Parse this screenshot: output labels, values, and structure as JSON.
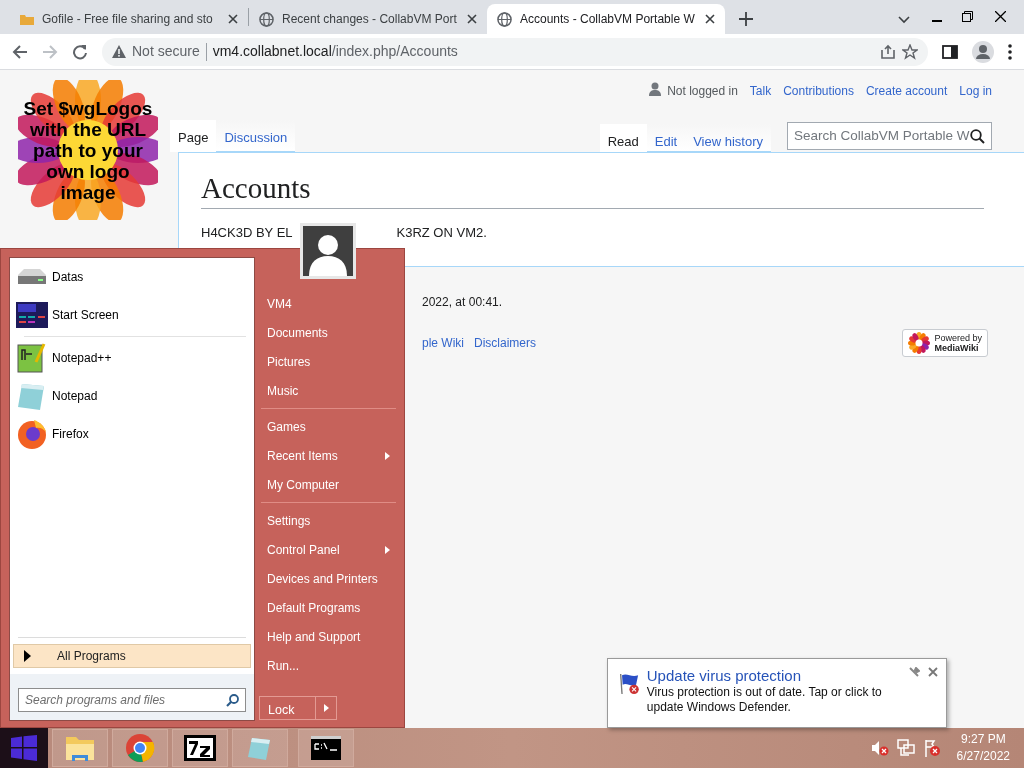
{
  "browser": {
    "tabs": [
      {
        "title": "Gofile - Free file sharing and sto",
        "selected": false
      },
      {
        "title": "Recent changes - CollabVM Port",
        "selected": false
      },
      {
        "title": "Accounts - CollabVM Portable W",
        "selected": true
      }
    ],
    "address": {
      "security": "Not secure",
      "host": "vm4.collabnet.local",
      "path": "/index.php/Accounts"
    }
  },
  "wiki": {
    "logo_text": "Set $wgLogos with the URL path to your own logo image",
    "personal": [
      "Not logged in",
      "Talk",
      "Contributions",
      "Create account",
      "Log in"
    ],
    "left_tabs": [
      {
        "label": "Page",
        "selected": true
      },
      {
        "label": "Discussion",
        "selected": false
      }
    ],
    "right_tabs": [
      {
        "label": "Read",
        "selected": true
      },
      {
        "label": "Edit",
        "selected": false
      },
      {
        "label": "View history",
        "selected": false
      }
    ],
    "search": {
      "placeholder": "Search CollabVM Portable W"
    },
    "heading": "Accounts",
    "body_parts": [
      "H4CK3D BY EL",
      "K3RZ ON VM2."
    ],
    "footer": {
      "last_edited": "2022, at 00:41.",
      "links": [
        "ple Wiki",
        "Disclaimers"
      ],
      "powered_by": [
        "Powered by",
        "MediaWiki"
      ]
    }
  },
  "start_menu": {
    "pinned_groups": [
      [
        "Datas",
        "Start Screen"
      ],
      [
        "Notepad++",
        "Notepad",
        "Firefox"
      ]
    ],
    "all_programs": "All Programs",
    "search": {
      "placeholder": "Search programs and files"
    },
    "right_groups": [
      [
        {
          "label": "VM4",
          "submenu": false
        },
        {
          "label": "Documents",
          "submenu": false
        },
        {
          "label": "Pictures",
          "submenu": false
        },
        {
          "label": "Music",
          "submenu": false
        }
      ],
      [
        {
          "label": "Games",
          "submenu": false
        },
        {
          "label": "Recent Items",
          "submenu": true
        },
        {
          "label": "My Computer",
          "submenu": false
        }
      ],
      [
        {
          "label": "Settings",
          "submenu": false
        },
        {
          "label": "Control Panel",
          "submenu": true
        },
        {
          "label": "Devices and Printers",
          "submenu": false
        },
        {
          "label": "Default Programs",
          "submenu": false
        },
        {
          "label": "Help and Support",
          "submenu": false
        },
        {
          "label": "Run...",
          "submenu": false
        }
      ]
    ],
    "lock": "Lock"
  },
  "notification": {
    "title": "Update virus protection",
    "message": "Virus protection is out of date. Tap or click to update Windows Defender."
  },
  "clock": {
    "time": "9:27 PM",
    "date": "6/27/2022"
  }
}
